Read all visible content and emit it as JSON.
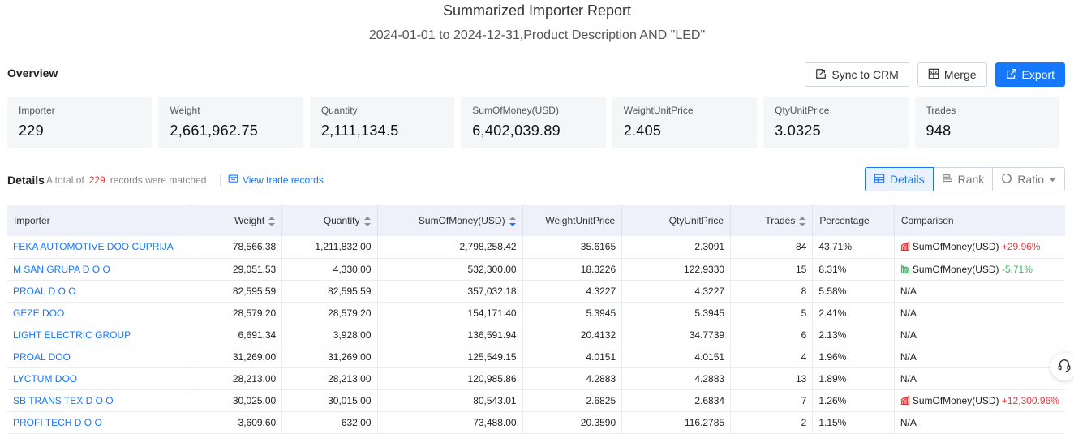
{
  "report": {
    "title": "Summarized Importer Report",
    "subtitle": "2024-01-01 to 2024-12-31,Product Description AND \"LED\""
  },
  "overview": {
    "title": "Overview",
    "actions": {
      "sync": "Sync to CRM",
      "merge": "Merge",
      "export": "Export"
    },
    "stats": [
      {
        "label": "Importer",
        "value": "229"
      },
      {
        "label": "Weight",
        "value": "2,661,962.75"
      },
      {
        "label": "Quantity",
        "value": "2,111,134.5"
      },
      {
        "label": "SumOfMoney(USD)",
        "value": "6,402,039.89"
      },
      {
        "label": "WeightUnitPrice",
        "value": "2.405"
      },
      {
        "label": "QtyUnitPrice",
        "value": "3.0325"
      },
      {
        "label": "Trades",
        "value": "948"
      }
    ]
  },
  "details": {
    "title": "Details",
    "meta_prefix": "A total of",
    "count": "229",
    "meta_suffix": "records were matched",
    "view_link": "View trade records",
    "views": {
      "details": "Details",
      "rank": "Rank",
      "ratio": "Ratio"
    }
  },
  "table": {
    "headers": {
      "importer": "Importer",
      "weight": "Weight",
      "quantity": "Quantity",
      "money": "SumOfMoney(USD)",
      "wup": "WeightUnitPrice",
      "qup": "QtyUnitPrice",
      "trades": "Trades",
      "percentage": "Percentage",
      "comparison": "Comparison"
    },
    "rows": [
      {
        "importer": "FEKA AUTOMOTIVE DOO CUPRIJA",
        "weight": "78,566.38",
        "quantity": "1,211,832.00",
        "money": "2,798,258.42",
        "wup": "35.6165",
        "qup": "2.3091",
        "trades": "84",
        "percentage": "43.71%",
        "cmp_label": "SumOfMoney(USD)",
        "cmp_value": "+29.96%",
        "cmp_dir": "up",
        "na": ""
      },
      {
        "importer": "M SAN GRUPA D O O",
        "weight": "29,051.53",
        "quantity": "4,330.00",
        "money": "532,300.00",
        "wup": "18.3226",
        "qup": "122.9330",
        "trades": "15",
        "percentage": "8.31%",
        "cmp_label": "SumOfMoney(USD)",
        "cmp_value": "-5.71%",
        "cmp_dir": "down",
        "na": ""
      },
      {
        "importer": "PROAL D O O",
        "weight": "82,595.59",
        "quantity": "82,595.59",
        "money": "357,032.18",
        "wup": "4.3227",
        "qup": "4.3227",
        "trades": "8",
        "percentage": "5.58%",
        "cmp_label": "",
        "cmp_value": "",
        "cmp_dir": "",
        "na": "N/A"
      },
      {
        "importer": "GEZE DOO",
        "weight": "28,579.20",
        "quantity": "28,579.20",
        "money": "154,171.40",
        "wup": "5.3945",
        "qup": "5.3945",
        "trades": "5",
        "percentage": "2.41%",
        "cmp_label": "",
        "cmp_value": "",
        "cmp_dir": "",
        "na": "N/A"
      },
      {
        "importer": "LIGHT ELECTRIC GROUP",
        "weight": "6,691.34",
        "quantity": "3,928.00",
        "money": "136,591.94",
        "wup": "20.4132",
        "qup": "34.7739",
        "trades": "6",
        "percentage": "2.13%",
        "cmp_label": "",
        "cmp_value": "",
        "cmp_dir": "",
        "na": "N/A"
      },
      {
        "importer": "PROAL DOO",
        "weight": "31,269.00",
        "quantity": "31,269.00",
        "money": "125,549.15",
        "wup": "4.0151",
        "qup": "4.0151",
        "trades": "4",
        "percentage": "1.96%",
        "cmp_label": "",
        "cmp_value": "",
        "cmp_dir": "",
        "na": "N/A"
      },
      {
        "importer": "LYCTUM DOO",
        "weight": "28,213.00",
        "quantity": "28,213.00",
        "money": "120,985.86",
        "wup": "4.2883",
        "qup": "4.2883",
        "trades": "13",
        "percentage": "1.89%",
        "cmp_label": "",
        "cmp_value": "",
        "cmp_dir": "",
        "na": "N/A"
      },
      {
        "importer": "SB TRANS TEX D O O",
        "weight": "30,025.00",
        "quantity": "30,015.00",
        "money": "80,543.01",
        "wup": "2.6825",
        "qup": "2.6834",
        "trades": "7",
        "percentage": "1.26%",
        "cmp_label": "SumOfMoney(USD)",
        "cmp_value": "+12,300.96%",
        "cmp_dir": "up",
        "na": ""
      },
      {
        "importer": "PROFI TECH D O O",
        "weight": "3,609.60",
        "quantity": "632.00",
        "money": "73,488.00",
        "wup": "20.3590",
        "qup": "116.2785",
        "trades": "2",
        "percentage": "1.15%",
        "cmp_label": "",
        "cmp_value": "",
        "cmp_dir": "",
        "na": "N/A"
      }
    ]
  },
  "colors": {
    "accent": "#1677ff",
    "positive": "#e4393c",
    "negative": "#3bb55f",
    "header_bg": "#eef1f9",
    "card_bg": "#f5f6f8"
  },
  "icons": {
    "sync": "sync-crm-icon",
    "merge": "merge-icon",
    "export": "export-icon",
    "details": "table-icon",
    "rank": "rank-bars-icon",
    "ratio": "ratio-ring-icon",
    "help": "headset-icon"
  }
}
